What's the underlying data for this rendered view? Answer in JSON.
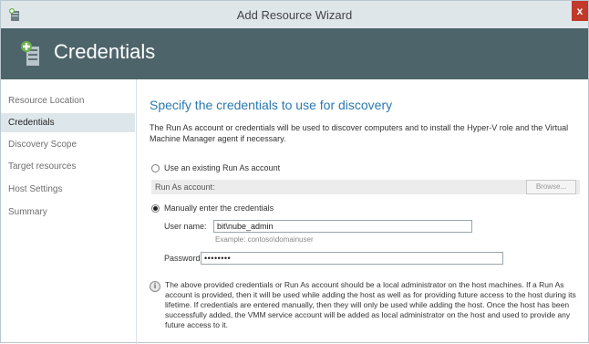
{
  "window": {
    "title": "Add Resource Wizard",
    "close_label": "x"
  },
  "banner": {
    "title": "Credentials"
  },
  "sidebar": {
    "items": [
      {
        "label": "Resource Location",
        "active": false
      },
      {
        "label": "Credentials",
        "active": true
      },
      {
        "label": "Discovery Scope",
        "active": false
      },
      {
        "label": "Target resources",
        "active": false
      },
      {
        "label": "Host Settings",
        "active": false
      },
      {
        "label": "Summary",
        "active": false
      }
    ]
  },
  "main": {
    "heading": "Specify the credentials to use for discovery",
    "description": "The Run As account or credentials will be used to discover computers and to install the Hyper-V role and the Virtual Machine Manager agent if necessary.",
    "option_existing": {
      "label": "Use an existing Run As account",
      "selected": false
    },
    "run_as_label": "Run As account:",
    "run_as_value": "",
    "browse_label": "Browse...",
    "option_manual": {
      "label": "Manually enter the credentials",
      "selected": true
    },
    "username_label": "User name:",
    "username_value": "bit\\nube_admin",
    "username_example": "Example: contoso\\domainuser",
    "password_label": "Password:",
    "password_value": "••••••••",
    "info_text": "The above provided credentials or Run As account should be a local administrator on the host machines. If a Run As account is provided, then it will be used while adding the host as well as for providing future access to the host during its lifetime. If credentials are entered manually, then they will only be used while adding the host. Once the host has been successfully added, the VMM service account will be added as local administrator on the host and used to provide any future access to it."
  },
  "colors": {
    "banner": "#4e646b",
    "heading": "#2a79b0",
    "close": "#c0392b",
    "active_nav": "#dde6ea"
  },
  "icons": {
    "title": "server-add-icon",
    "banner": "server-add-icon",
    "info": "info-icon"
  }
}
